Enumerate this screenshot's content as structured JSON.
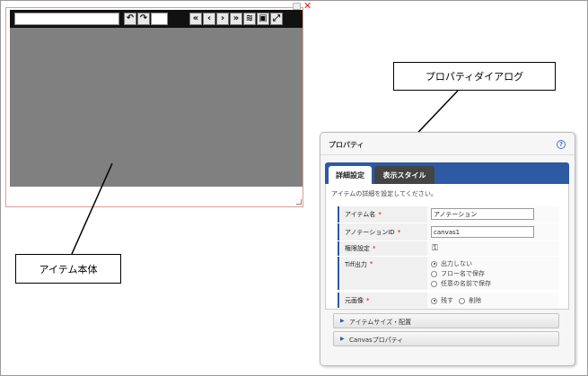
{
  "callouts": {
    "item_body": "アイテム本体",
    "property_dialog": "プロパティダイアログ"
  },
  "toolbar": {
    "icons": [
      "undo-icon",
      "redo-icon",
      "first-page-icon",
      "prev-page-icon",
      "next-page-icon",
      "last-page-icon",
      "layers-icon",
      "image-icon",
      "fullscreen-icon"
    ]
  },
  "dialog": {
    "title": "プロパティ",
    "help": "?",
    "tabs": [
      {
        "label": "詳細設定",
        "active": true
      },
      {
        "label": "表示スタイル",
        "active": false
      }
    ],
    "description": "アイテムの詳細を設定してください。",
    "rows": {
      "item_name": {
        "label": "アイテム名",
        "value": "アノテーション"
      },
      "annotation_id": {
        "label": "アノテーションID",
        "value": "canvas1"
      },
      "permission": {
        "label": "権限設定"
      },
      "tiff_output": {
        "label": "Tiff出力",
        "options": [
          "出力しない",
          "フロー名で保存",
          "任意の名前で保存"
        ],
        "selected": "出力しない"
      },
      "original_image": {
        "label": "元画像",
        "options": [
          "残す",
          "削除"
        ],
        "selected": "残す"
      }
    },
    "required_mark": "*",
    "accordions": [
      "アイテムサイズ・配置",
      "Canvasプロパティ"
    ]
  },
  "colors": {
    "accent": "#2d5aa2",
    "toolbar_bg": "#111111",
    "canvas_bg": "#808080",
    "item_border": "#e59a9a",
    "required": "#dd0000"
  }
}
